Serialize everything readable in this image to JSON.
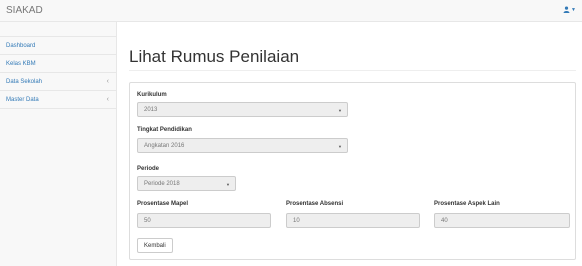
{
  "navbar": {
    "brand": "SIAKAD",
    "user_icon": "user-icon",
    "caret_icon": "caret-down-icon"
  },
  "sidebar": {
    "items": [
      {
        "label": "Dashboard"
      },
      {
        "label": "Kelas KBM"
      },
      {
        "label": "Data Sekolah",
        "icon": "chevron-left-icon"
      },
      {
        "label": "Master Data",
        "icon": "chevron-left-icon"
      }
    ]
  },
  "main": {
    "title": "Lihat Rumus Penilaian",
    "kurikulum": {
      "label": "Kurikulum",
      "value": "2013"
    },
    "tingkat": {
      "label": "Tingkat Pendidikan",
      "value": "Angkatan 2016"
    },
    "periode": {
      "label": "Periode",
      "value": "Periode 2018"
    },
    "prosentase_mapel": {
      "label": "Prosentase Mapel",
      "value": "50"
    },
    "prosentase_absensi": {
      "label": "Prosentase Absensi",
      "value": "10"
    },
    "prosentase_aspek": {
      "label": "Prosentase Aspek Lain",
      "value": "40"
    },
    "kembali_label": "Kembali"
  },
  "colors": {
    "link": "#337ab7",
    "navbar_bg": "#f8f8f8",
    "field_bg": "#eeeeee",
    "border": "#dddddd"
  }
}
